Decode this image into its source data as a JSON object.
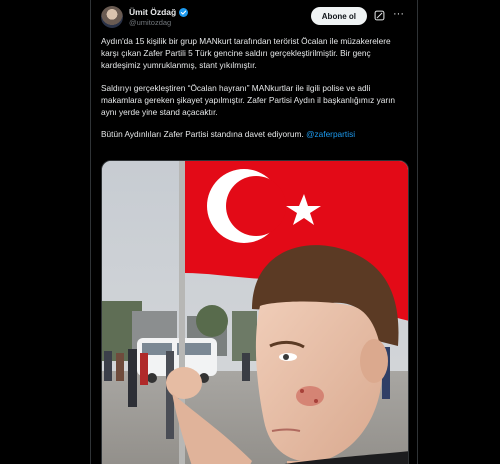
{
  "author": {
    "name": "Ümit Özdağ",
    "handle": "@umitozdag",
    "verified": true
  },
  "actions": {
    "follow_label": "Abone ol",
    "grok_icon": "grok-icon",
    "more_icon": "more-icon"
  },
  "tweet": {
    "paragraph1": "Aydın'da 15 kişilik bir grup MANkurt tarafından terörist Öcalan ile müzakerelere karşı çıkan Zafer Partili 5 Türk gencine saldırı gerçekleştirilmiştir. Bir genç kardeşimiz yumruklanmış, stant yıkılmıştır.",
    "paragraph2": "Saldırıyı gerçekleştiren “Öcalan hayranı” MANkurtlar ile ilgili polise ve adli makamlara gereken şikayet yapılmıştır. Zafer Partisi Aydın il başkanlığımız yarın aynı yerde yine stand açacaktır.",
    "paragraph3_text": "Bütün Aydınlıları Zafer Partisi standına davet ediyorum. ",
    "paragraph3_mention": "@zaferpartisi"
  },
  "colors": {
    "background": "#000000",
    "text": "#e7e9ea",
    "muted": "#71767b",
    "accent": "#1d9bf0",
    "flag_red": "#e30a17"
  }
}
